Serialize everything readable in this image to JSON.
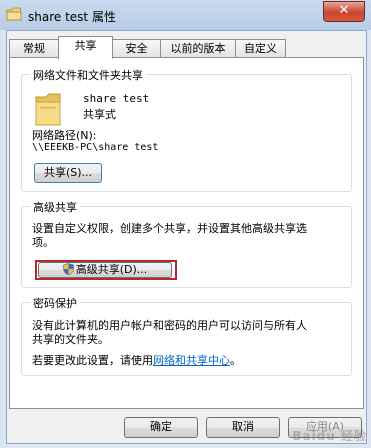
{
  "window": {
    "title": "share test 属性",
    "close_glyph": "✕"
  },
  "tabs": [
    {
      "label": "常规"
    },
    {
      "label": "共享"
    },
    {
      "label": "安全"
    },
    {
      "label": "以前的版本"
    },
    {
      "label": "自定义"
    }
  ],
  "network_share": {
    "group_title": "网络文件和文件夹共享",
    "folder_name": "share test",
    "share_status": "共享式",
    "path_label": "网络路径(N):",
    "path_value": "\\\\EEEKB-PC\\share test",
    "share_button": "共享(S)..."
  },
  "advanced": {
    "group_title": "高级共享",
    "description": "设置自定义权限，创建多个共享，并设置其他高级共享选项。",
    "description_line1": "设置自定义权限，创建多个共享，并设置其他高级共享选",
    "description_line2": "项。",
    "button": "高级共享(D)..."
  },
  "password": {
    "group_title": "密码保护",
    "text_line1": "没有此计算机的用户帐户和密码的用户可以访问与所有人",
    "text_line2": "共享的文件夹。",
    "change_prefix": "若要更改此设置，请使用",
    "link": "网络和共享中心",
    "change_suffix": "。"
  },
  "buttons": {
    "ok": "确定",
    "cancel": "取消",
    "apply": "应用(A)"
  },
  "watermark": "Baidu 经验",
  "colors": {
    "highlight_border": "#b12b2b",
    "link": "#0066cc",
    "titlebar": "#b7cde6"
  }
}
